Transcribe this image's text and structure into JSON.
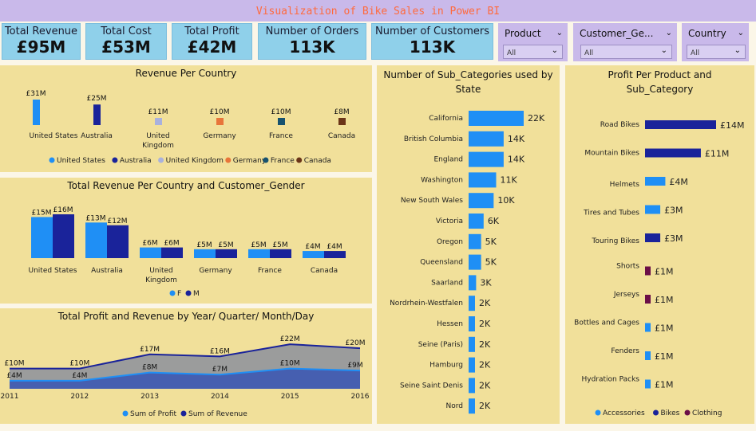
{
  "header": {
    "title": "Visualization of Bike Sales in Power BI"
  },
  "kpis": [
    {
      "label": "Total Revenue",
      "value": "£95M"
    },
    {
      "label": "Total Cost",
      "value": "£53M"
    },
    {
      "label": "Total Profit",
      "value": "£42M"
    },
    {
      "label": "Number of Orders",
      "value": "113K"
    },
    {
      "label": "Number of Customers",
      "value": "113K"
    }
  ],
  "slicers": [
    {
      "label": "Product",
      "value": "All"
    },
    {
      "label": "Customer_Ge...",
      "value": "All"
    },
    {
      "label": "Country",
      "value": "All"
    }
  ],
  "colors": {
    "blue": "#1f8ff5",
    "navy": "#1a239a",
    "lavender": "#a9b1dd",
    "orange": "#e8753a",
    "teal": "#17526f",
    "brown": "#6b3518",
    "maroon": "#6b0f47"
  },
  "chart_data": [
    {
      "type": "bar",
      "title": "Revenue Per Country",
      "categories": [
        "United States",
        "Australia",
        "United Kingdom",
        "Germany",
        "France",
        "Canada"
      ],
      "values": [
        31,
        25,
        11,
        10,
        10,
        8
      ],
      "labels": [
        "£31M",
        "£25M",
        "£11M",
        "£10M",
        "£10M",
        "£8M"
      ],
      "legend": [
        "United States",
        "Australia",
        "United Kingdom",
        "Germany",
        "France",
        "Canada"
      ]
    },
    {
      "type": "bar",
      "title": "Total Revenue Per Country and Customer_Gender",
      "categories": [
        "United States",
        "Australia",
        "United Kingdom",
        "Germany",
        "France",
        "Canada"
      ],
      "series": [
        {
          "name": "F",
          "values": [
            15,
            13,
            6,
            5,
            5,
            4
          ],
          "labels": [
            "£15M",
            "£13M",
            "£6M",
            "£5M",
            "£5M",
            "£4M"
          ]
        },
        {
          "name": "M",
          "values": [
            16,
            12,
            6,
            5,
            5,
            4
          ],
          "labels": [
            "£16M",
            "£12M",
            "£6M",
            "£5M",
            "£5M",
            "£4M"
          ]
        }
      ]
    },
    {
      "type": "area",
      "title": "Total Profit and Revenue by Year/ Quarter/ Month/Day",
      "x": [
        2011,
        2012,
        2013,
        2014,
        2015,
        2016
      ],
      "series": [
        {
          "name": "Sum of Profit",
          "values": [
            4,
            4,
            8,
            7,
            10,
            9
          ],
          "labels": [
            "£4M",
            "£4M",
            "£8M",
            "£7M",
            "£10M",
            "£9M"
          ]
        },
        {
          "name": "Sum of Revenue",
          "values": [
            10,
            10,
            17,
            16,
            22,
            20
          ],
          "labels": [
            "£10M",
            "£10M",
            "£17M",
            "£16M",
            "£22M",
            "£20M"
          ]
        }
      ]
    },
    {
      "type": "bar",
      "title": "Number of Sub_Categories used by State",
      "categories": [
        "California",
        "British Columbia",
        "England",
        "Washington",
        "New South Wales",
        "Victoria",
        "Oregon",
        "Queensland",
        "Saarland",
        "Nordrhein-Westfalen",
        "Hessen",
        "Seine (Paris)",
        "Hamburg",
        "Seine Saint Denis",
        "Nord"
      ],
      "values": [
        22,
        14,
        14,
        11,
        10,
        6,
        5,
        5,
        3,
        2,
        2,
        2,
        2,
        2,
        2
      ],
      "labels": [
        "22K",
        "14K",
        "14K",
        "11K",
        "10K",
        "6K",
        "5K",
        "5K",
        "3K",
        "2K",
        "2K",
        "2K",
        "2K",
        "2K",
        "2K"
      ]
    },
    {
      "type": "bar",
      "title": "Profit Per Product and Sub_Category",
      "categories": [
        "Road Bikes",
        "Mountain Bikes",
        "Helmets",
        "Tires and Tubes",
        "Touring Bikes",
        "Shorts",
        "Jerseys",
        "Bottles and Cages",
        "Fenders",
        "Hydration Packs"
      ],
      "values": [
        14,
        11,
        4,
        3,
        3,
        1,
        1,
        1,
        1,
        1
      ],
      "labels": [
        "£14M",
        "£11M",
        "£4M",
        "£3M",
        "£3M",
        "£1M",
        "£1M",
        "£1M",
        "£1M",
        "£1M"
      ],
      "groups": [
        "Bikes",
        "Bikes",
        "Accessories",
        "Accessories",
        "Bikes",
        "Clothing",
        "Clothing",
        "Accessories",
        "Accessories",
        "Accessories"
      ],
      "legend": [
        "Accessories",
        "Bikes",
        "Clothing"
      ]
    }
  ]
}
